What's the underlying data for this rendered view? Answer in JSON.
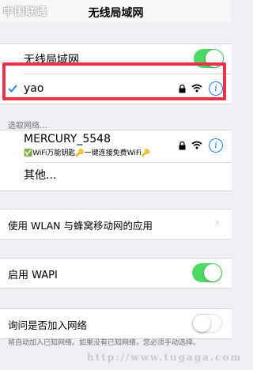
{
  "status_bar": {
    "carrier": "中国联通"
  },
  "nav": {
    "title": "无线局域网"
  },
  "wlan_toggle": {
    "label": "无线局域网",
    "on": true
  },
  "connected": {
    "name": "yao",
    "icons": [
      "checkmark-icon",
      "lock-icon",
      "wifi-icon",
      "info-icon"
    ]
  },
  "choose_network": {
    "header": "选取网络...",
    "networks": [
      {
        "name": "MERCURY_5548",
        "subtitle": "✅WiFi万能钥匙🔑一键连接免费WiFi🔑"
      },
      {
        "name": "其他..."
      }
    ]
  },
  "wlan_apps": {
    "label": "使用 WLAN 与蜂窝移动网的应用"
  },
  "wapi": {
    "label": "启用 WAPI",
    "on": true
  },
  "ask_join": {
    "label": "询问是否加入网络",
    "on": false,
    "footer": "将自动加入已知网络。如果没有已知网络，您必须手动选择。"
  },
  "watermark": "http://www.tugaga.com",
  "colors": {
    "switch_on": "#4cd964",
    "highlight": "#e8324a",
    "tint": "#1e7cf2"
  }
}
